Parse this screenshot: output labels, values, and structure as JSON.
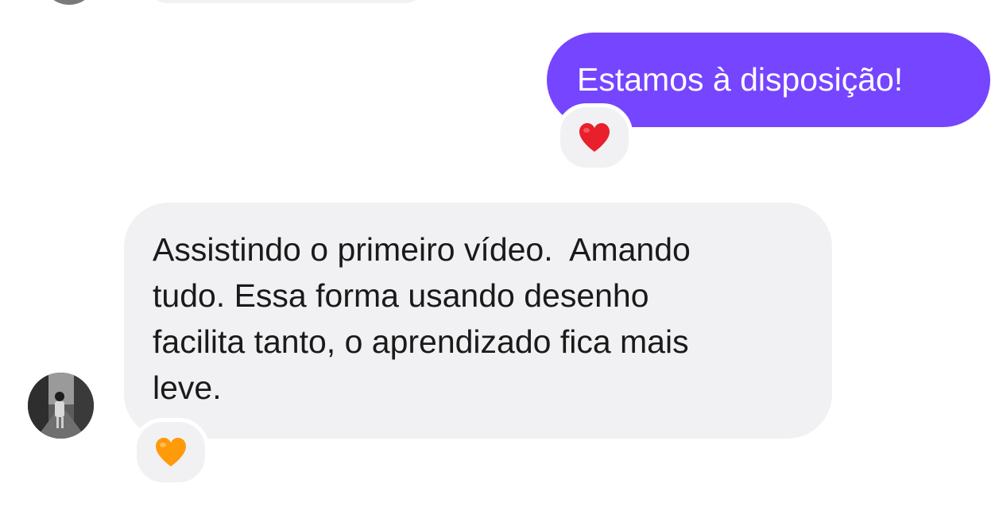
{
  "conversation": {
    "outgoing_message": {
      "text": "Estamos à disposição!",
      "reaction": "red-heart",
      "bubble_color": "#7645ff",
      "text_color": "#ffffff"
    },
    "incoming_message": {
      "lines": [
        "Assistindo o primeiro vídeo.  Amando",
        "tudo. Essa forma usando desenho",
        "facilita tanto, o aprendizado fica mais",
        "leve."
      ],
      "reaction": "orange-heart",
      "bubble_color": "#f1f1f3",
      "text_color": "#1a1a1a"
    },
    "sender_avatar_icon": "user-photo-avatar"
  }
}
